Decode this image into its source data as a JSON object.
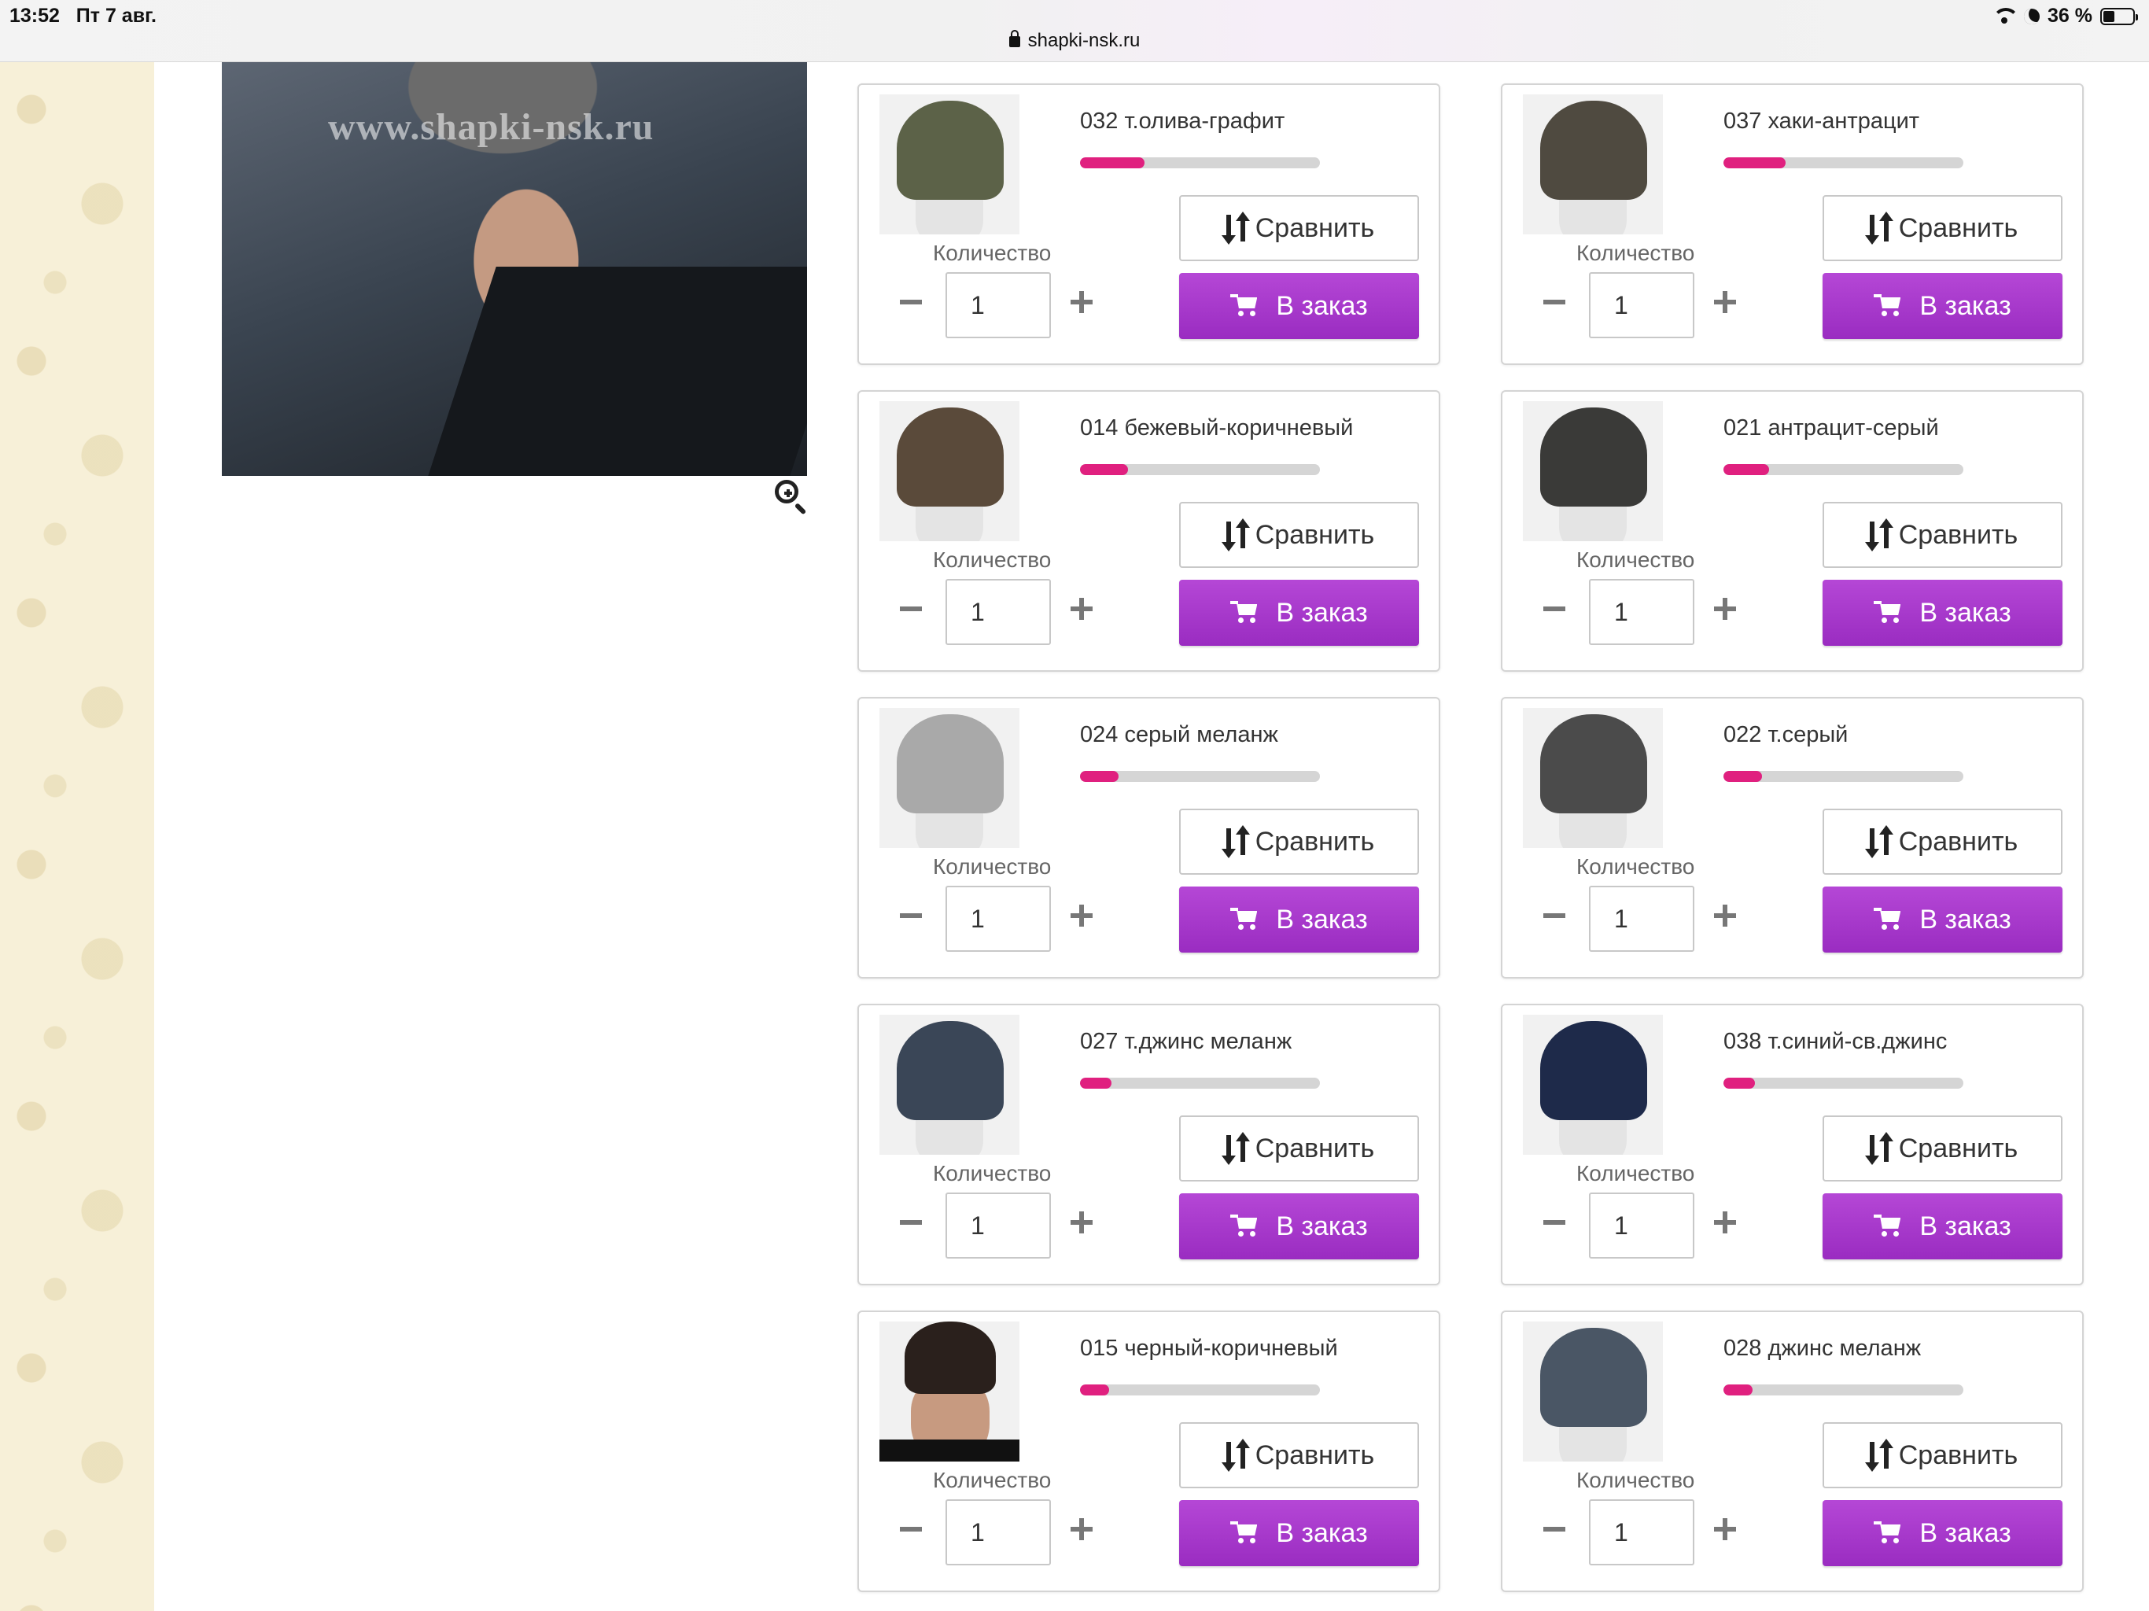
{
  "status_bar": {
    "time": "13:52",
    "date": "Пт 7 авг.",
    "url": "shapki-nsk.ru",
    "battery": "36 %"
  },
  "main_image": {
    "watermark": "www.shapki-nsk.ru"
  },
  "labels": {
    "quantity": "Количество",
    "compare": "Сравнить",
    "order": "В заказ"
  },
  "colors": {
    "accent_purple": "#a335c9",
    "progress_pink": "#e0207f",
    "progress_track": "#d5d5d5"
  },
  "products": [
    {
      "title": "032 т.олива-графит",
      "qty": "1",
      "stock_fraction": 0.27,
      "hat_color": "#5c6248",
      "thumb": "hat"
    },
    {
      "title": "037 хаки-антрацит",
      "qty": "1",
      "stock_fraction": 0.26,
      "hat_color": "#4f4a40",
      "thumb": "hat"
    },
    {
      "title": "014 бежевый-коричневый",
      "qty": "1",
      "stock_fraction": 0.2,
      "hat_color": "#5a4a3a",
      "thumb": "hat"
    },
    {
      "title": "021 антрацит-серый",
      "qty": "1",
      "stock_fraction": 0.19,
      "hat_color": "#3a3a38",
      "thumb": "hat"
    },
    {
      "title": "024 серый меланж",
      "qty": "1",
      "stock_fraction": 0.16,
      "hat_color": "#a9a9a9",
      "thumb": "hat"
    },
    {
      "title": "022 т.серый",
      "qty": "1",
      "stock_fraction": 0.16,
      "hat_color": "#4b4b4b",
      "thumb": "hat"
    },
    {
      "title": "027 т.джинс меланж",
      "qty": "1",
      "stock_fraction": 0.13,
      "hat_color": "#3a4657",
      "thumb": "hat"
    },
    {
      "title": "038 т.синий-св.джинс",
      "qty": "1",
      "stock_fraction": 0.13,
      "hat_color": "#1e2a4a",
      "thumb": "hat"
    },
    {
      "title": "015 черный-коричневый",
      "qty": "1",
      "stock_fraction": 0.12,
      "hat_color": "#2a201c",
      "thumb": "person"
    },
    {
      "title": "028 джинс меланж",
      "qty": "1",
      "stock_fraction": 0.12,
      "hat_color": "#4a5665",
      "thumb": "hat"
    }
  ]
}
